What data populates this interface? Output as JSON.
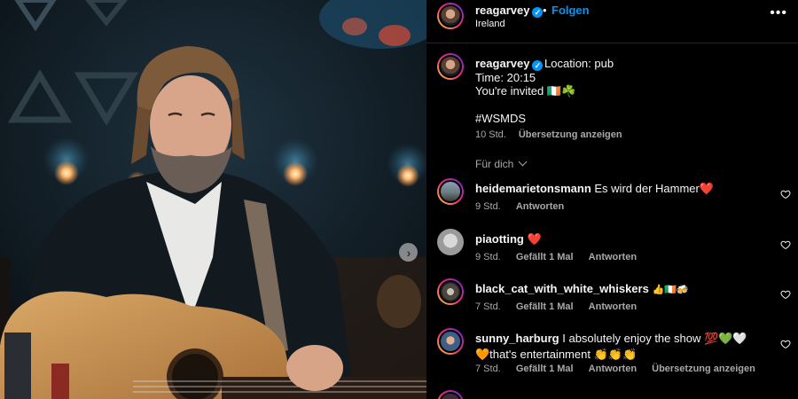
{
  "post": {
    "username": "reagarvey",
    "follow_label": "Folgen",
    "location": "Ireland",
    "more_label": "•••",
    "next_label": "›"
  },
  "caption": {
    "username": "reagarvey",
    "line1": "Location: pub",
    "line2": "Time: 20:15",
    "line3": "You're invited 🇮🇪☘️",
    "hashtag": "#WSMDS",
    "time": "10 Std.",
    "translate_label": "Übersetzung anzeigen"
  },
  "for_you_label": "Für dich",
  "comments": [
    {
      "username": "heidemarietonsmann",
      "text": "Es wird der Hammer❤️",
      "time": "9 Std.",
      "likes": "",
      "reply_label": "Antworten",
      "translate_label": ""
    },
    {
      "username": "piaotting",
      "text": "❤️",
      "time": "9 Std.",
      "likes": "Gefällt 1 Mal",
      "reply_label": "Antworten",
      "translate_label": ""
    },
    {
      "username": "black_cat_with_white_whiskers",
      "text": "👍🇮🇪🍻",
      "time": "7 Std.",
      "likes": "Gefällt 1 Mal",
      "reply_label": "Antworten",
      "translate_label": ""
    },
    {
      "username": "sunny_harburg",
      "text": "I absolutely enjoy the show 💯💚🤍🧡that's entertainment 👏👏👏",
      "time": "7 Std.",
      "likes": "Gefällt 1 Mal",
      "reply_label": "Antworten",
      "translate_label": "Übersetzung anzeigen"
    }
  ],
  "icons": {
    "verified": "verified-badge-icon",
    "heart": "heart-outline-icon",
    "more": "more-options-icon",
    "next": "chevron-right-icon",
    "chevron": "chevron-down-icon"
  },
  "colors": {
    "accent": "#0095f6",
    "background": "#000000",
    "muted_text": "#a8a8a8"
  }
}
